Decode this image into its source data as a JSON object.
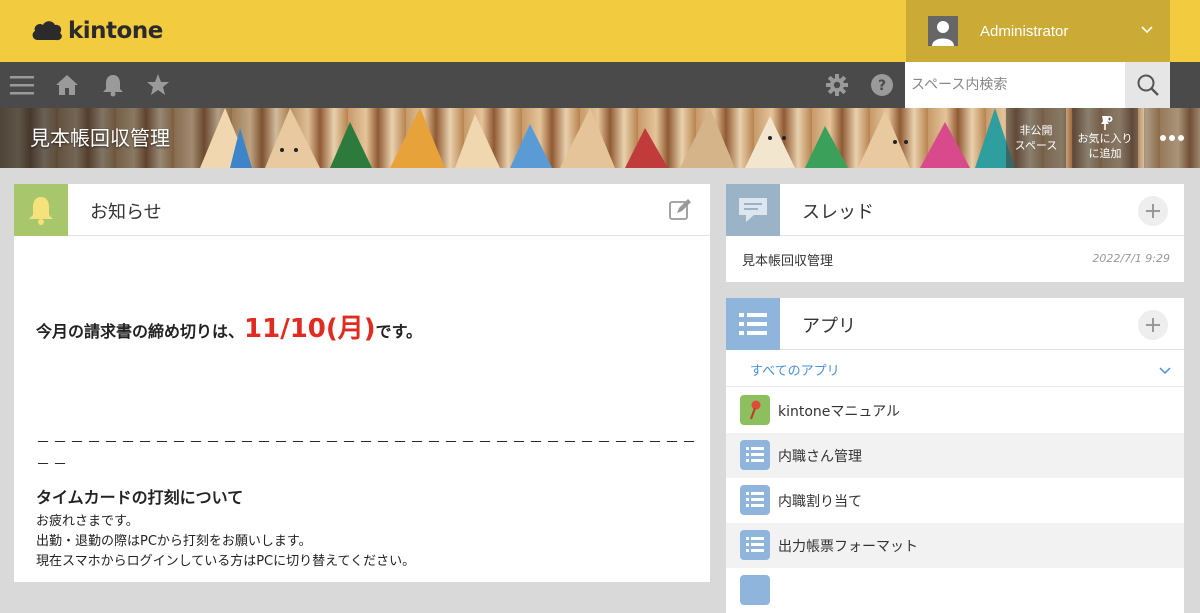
{
  "brand": {
    "logo_text": "kintone"
  },
  "user": {
    "name": "Administrator"
  },
  "nav": {
    "items": [
      {
        "icon": "menu-icon"
      },
      {
        "icon": "home-icon"
      },
      {
        "icon": "bell-icon"
      },
      {
        "icon": "star-icon"
      }
    ],
    "settings_icon": "gear-icon",
    "help_icon": "help-icon"
  },
  "search": {
    "placeholder": "スペース内検索",
    "value": ""
  },
  "space": {
    "title": "見本帳回収管理",
    "private_label": "非公開\nスペース",
    "private_line1": "非公開",
    "private_line2": "スペース",
    "favorite_line1": "お気に入り",
    "favorite_line2": "に追加"
  },
  "notice": {
    "title": "お知らせ",
    "deadline_prefix": "今月の請求書の締め切りは、",
    "deadline_date": "11/10(月)",
    "deadline_suffix": "です。",
    "dashes_line1": "－－－－－－－－－－－－－－－－－－－－－－－－－－－－－－－－－－－－－－－－",
    "dashes_line2": "－－",
    "timecard_title": "タイムカードの打刻について",
    "lines": [
      "お疲れさまです。",
      "出勤・退勤の際はPCから打刻をお願いします。",
      "現在スマホからログインしている方はPCに切り替えてください。"
    ]
  },
  "threads": {
    "title": "スレッド",
    "items": [
      {
        "name": "見本帳回収管理",
        "date": "2022/7/1 9:29"
      }
    ]
  },
  "apps": {
    "title": "アプリ",
    "filter_label": "すべてのアプリ",
    "items": [
      {
        "name": "kintoneマニュアル",
        "icon": "pin-icon"
      },
      {
        "name": "内職さん管理",
        "icon": "list-icon"
      },
      {
        "name": "内職割り当て",
        "icon": "list-icon"
      },
      {
        "name": "出力帳票フォーマット",
        "icon": "list-icon"
      }
    ]
  },
  "colors": {
    "header": "#f2cb3e",
    "navbar": "#4a4a4a",
    "accent_red": "#e02b20",
    "link_blue": "#4a90d9"
  }
}
